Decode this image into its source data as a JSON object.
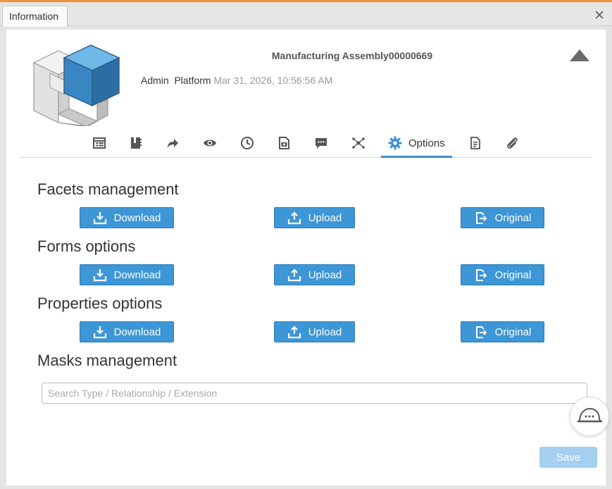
{
  "window": {
    "tab_label": "Information",
    "close_symbol": "✕"
  },
  "header": {
    "title": "Manufacturing Assembly00000669",
    "owner": "Admin",
    "collab_space": "Platform",
    "date": "Mar 31, 2026, 10:56:56 AM"
  },
  "toolbar": {
    "icons": [
      "properties-icon",
      "bookmark-icon",
      "share-icon",
      "preview-icon",
      "history-icon",
      "3d-file-icon",
      "comments-icon",
      "relations-icon",
      "options-icon",
      "document-icon",
      "attachment-icon"
    ],
    "active_label": "Options"
  },
  "sections": {
    "facets": "Facets management",
    "forms": "Forms options",
    "properties": "Properties options",
    "masks": "Masks management"
  },
  "buttons": {
    "download": "Download",
    "upload": "Upload",
    "original": "Original"
  },
  "search": {
    "placeholder": "Search Type / Relationship / Extension"
  },
  "footer": {
    "save": "Save"
  },
  "colors": {
    "accent": "#3d96d6",
    "tab_top": "#f0913a",
    "save_disabled": "#a5cff0"
  }
}
